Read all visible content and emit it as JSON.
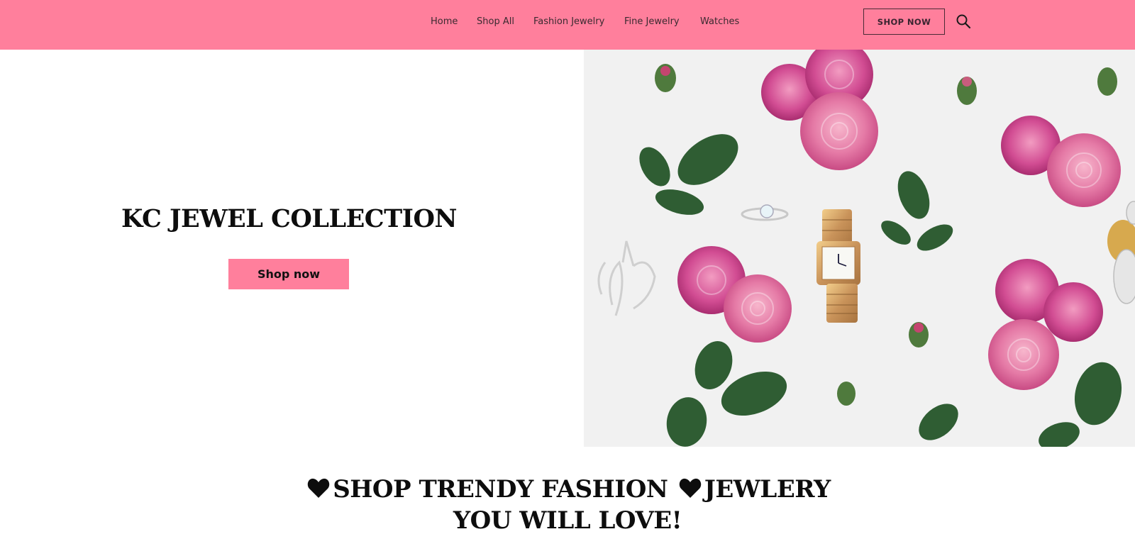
{
  "header": {
    "bg_color": "#ff7f9c",
    "nav": [
      {
        "label": "Home"
      },
      {
        "label": "Shop All"
      },
      {
        "label": "Fashion Jewelry"
      },
      {
        "label": "Fine Jewelry"
      },
      {
        "label": "Watches"
      }
    ],
    "shop_now_label": "SHOP NOW",
    "search_icon": "search-icon"
  },
  "hero": {
    "title": "KC JEWEL COLLECTION",
    "button_label": "Shop now",
    "image_icon": "jewelry-roses-photo"
  },
  "tagline": {
    "line1_part1": "SHOP TRENDY FASHION",
    "line1_part2": "JEWLERY",
    "line2": "YOU WILL LOVE!",
    "heart_icon": "heart-icon"
  }
}
